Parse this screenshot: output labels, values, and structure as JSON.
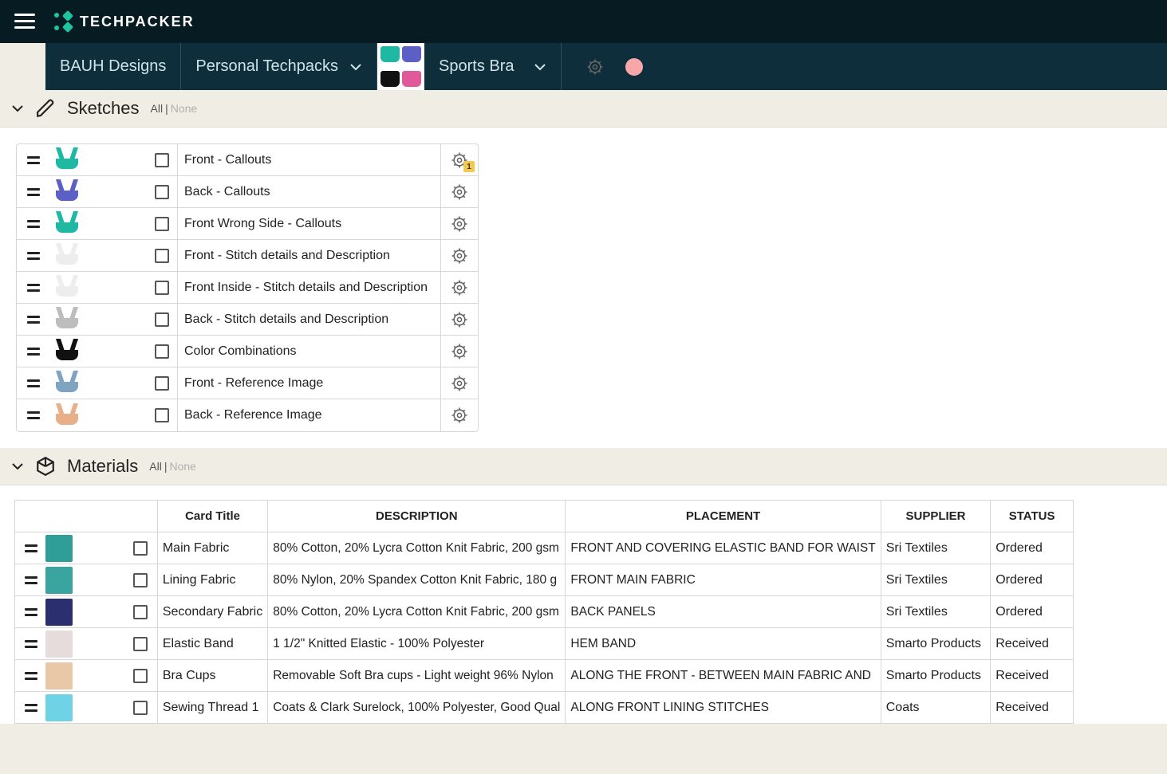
{
  "brand": "TECHPACKER",
  "breadcrumb": {
    "org": "BAUH Designs",
    "folder": "Personal Techpacks",
    "product": "Sports Bra"
  },
  "sections": {
    "sketches": {
      "title": "Sketches",
      "filter_all": "All",
      "filter_none": "None"
    },
    "materials": {
      "title": "Materials",
      "filter_all": "All",
      "filter_none": "None",
      "columns": {
        "card_title": "Card Title",
        "description": "DESCRIPTION",
        "placement": "PLACEMENT",
        "supplier": "SUPPLIER",
        "status": "STATUS"
      }
    }
  },
  "sketches": [
    {
      "name": "Front - Callouts",
      "thumb_bg": "#1FB9A3",
      "flag": true
    },
    {
      "name": "Back - Callouts",
      "thumb_bg": "#5C5FC4",
      "flag": false
    },
    {
      "name": "Front Wrong Side - Callouts",
      "thumb_bg": "#1FB9A3",
      "flag": false
    },
    {
      "name": "Front - Stitch details and Description",
      "thumb_bg": "#EDEDED",
      "flag": false
    },
    {
      "name": "Front Inside - Stitch details and Description",
      "thumb_bg": "#EDEDED",
      "flag": false
    },
    {
      "name": "Back - Stitch details and Description",
      "thumb_bg": "#BDBDBD",
      "flag": false
    },
    {
      "name": "Color Combinations",
      "thumb_bg": "#111111",
      "flag": false
    },
    {
      "name": "Front - Reference Image",
      "thumb_bg": "#7FA4C2",
      "flag": false
    },
    {
      "name": "Back - Reference Image",
      "thumb_bg": "#E8B089",
      "flag": false
    }
  ],
  "materials": [
    {
      "title": "Main Fabric",
      "thumb": "#2F9E99",
      "description": "80% Cotton, 20% Lycra Cotton Knit Fabric, 200 gsm",
      "placement": "FRONT AND COVERING ELASTIC BAND FOR WAIST",
      "supplier": "Sri Textiles",
      "status": "Ordered"
    },
    {
      "title": "Lining Fabric",
      "thumb": "#3AA59F",
      "description": "80% Nylon, 20% Spandex Cotton Knit Fabric, 180 g",
      "placement": "FRONT MAIN FABRIC",
      "supplier": "Sri Textiles",
      "status": "Ordered"
    },
    {
      "title": "Secondary Fabric",
      "thumb": "#2B2E6F",
      "description": "80% Cotton, 20% Lycra Cotton Knit Fabric, 200 gsm",
      "placement": "BACK PANELS",
      "supplier": "Sri Textiles",
      "status": "Ordered"
    },
    {
      "title": "Elastic Band",
      "thumb": "#E7DCDC",
      "description": "1 1/2\" Knitted Elastic - 100% Polyester",
      "placement": "HEM BAND",
      "supplier": "Smarto Products",
      "status": "Received"
    },
    {
      "title": "Bra Cups",
      "thumb": "#E9C8A8",
      "description": "Removable Soft Bra cups - Light weight 96% Nylon",
      "placement": "ALONG THE FRONT - BETWEEN MAIN FABRIC AND",
      "supplier": "Smarto Products",
      "status": "Received"
    },
    {
      "title": "Sewing Thread 1",
      "thumb": "#6FD3E5",
      "description": "Coats & Clark Surelock, 100% Polyester, Good Qual",
      "placement": "ALONG FRONT LINING STITCHES",
      "supplier": "Coats",
      "status": "Received"
    }
  ]
}
